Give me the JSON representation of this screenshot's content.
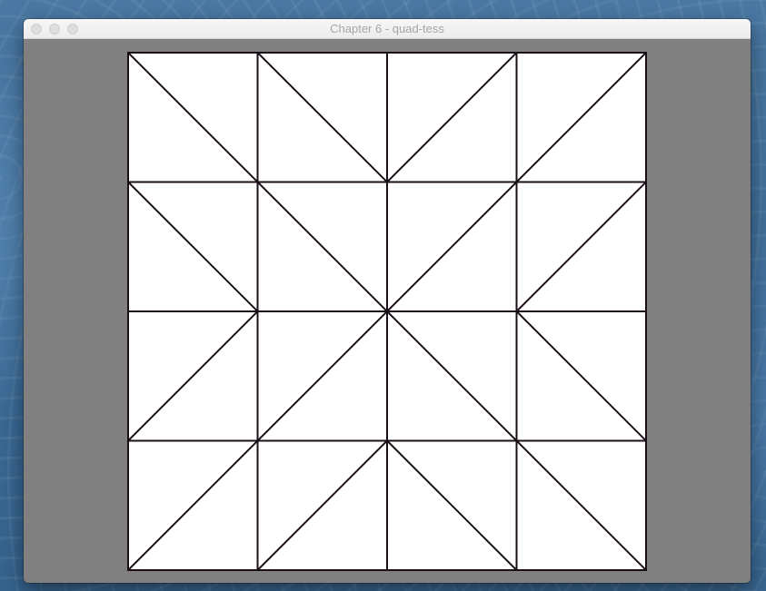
{
  "window": {
    "title": "Chapter 6 - quad-tess",
    "controls": [
      "close-icon",
      "minimize-icon",
      "zoom-icon"
    ]
  },
  "render": {
    "clear_color": "#808080",
    "fill_color": "#ffffff",
    "line_color": "#1a0f17",
    "mode": "wireframe",
    "grid": {
      "rows": 4,
      "cols": 4,
      "diagonals": [
        [
          "down",
          "down",
          "up",
          "up"
        ],
        [
          "down",
          "down",
          "up",
          "up"
        ],
        [
          "up",
          "up",
          "down",
          "down"
        ],
        [
          "up",
          "up",
          "down",
          "down"
        ]
      ]
    }
  }
}
